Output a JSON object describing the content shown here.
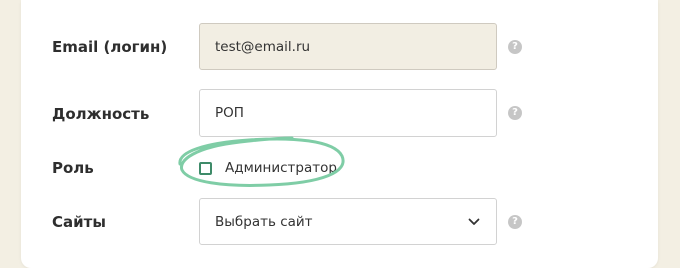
{
  "form": {
    "email": {
      "label": "Email (логин)",
      "value": "test@email.ru",
      "help": "?"
    },
    "position": {
      "label": "Должность",
      "value": "РОП",
      "help": "?"
    },
    "role": {
      "label": "Роль",
      "option_label": "Администратор",
      "checked": false
    },
    "sites": {
      "label": "Сайты",
      "selected": "Выбрать сайт",
      "help": "?"
    }
  },
  "colors": {
    "page_background": "#f3efe3",
    "card_background": "#ffffff",
    "readonly_field": "#f2eee3",
    "checkbox_border": "#3e8b69",
    "highlight_stroke": "#7fcda6",
    "help_icon": "#c6c6c6"
  },
  "icons": {
    "help": "question-circle-icon",
    "dropdown": "chevron-down-icon",
    "annotation": "hand-drawn-circle"
  }
}
